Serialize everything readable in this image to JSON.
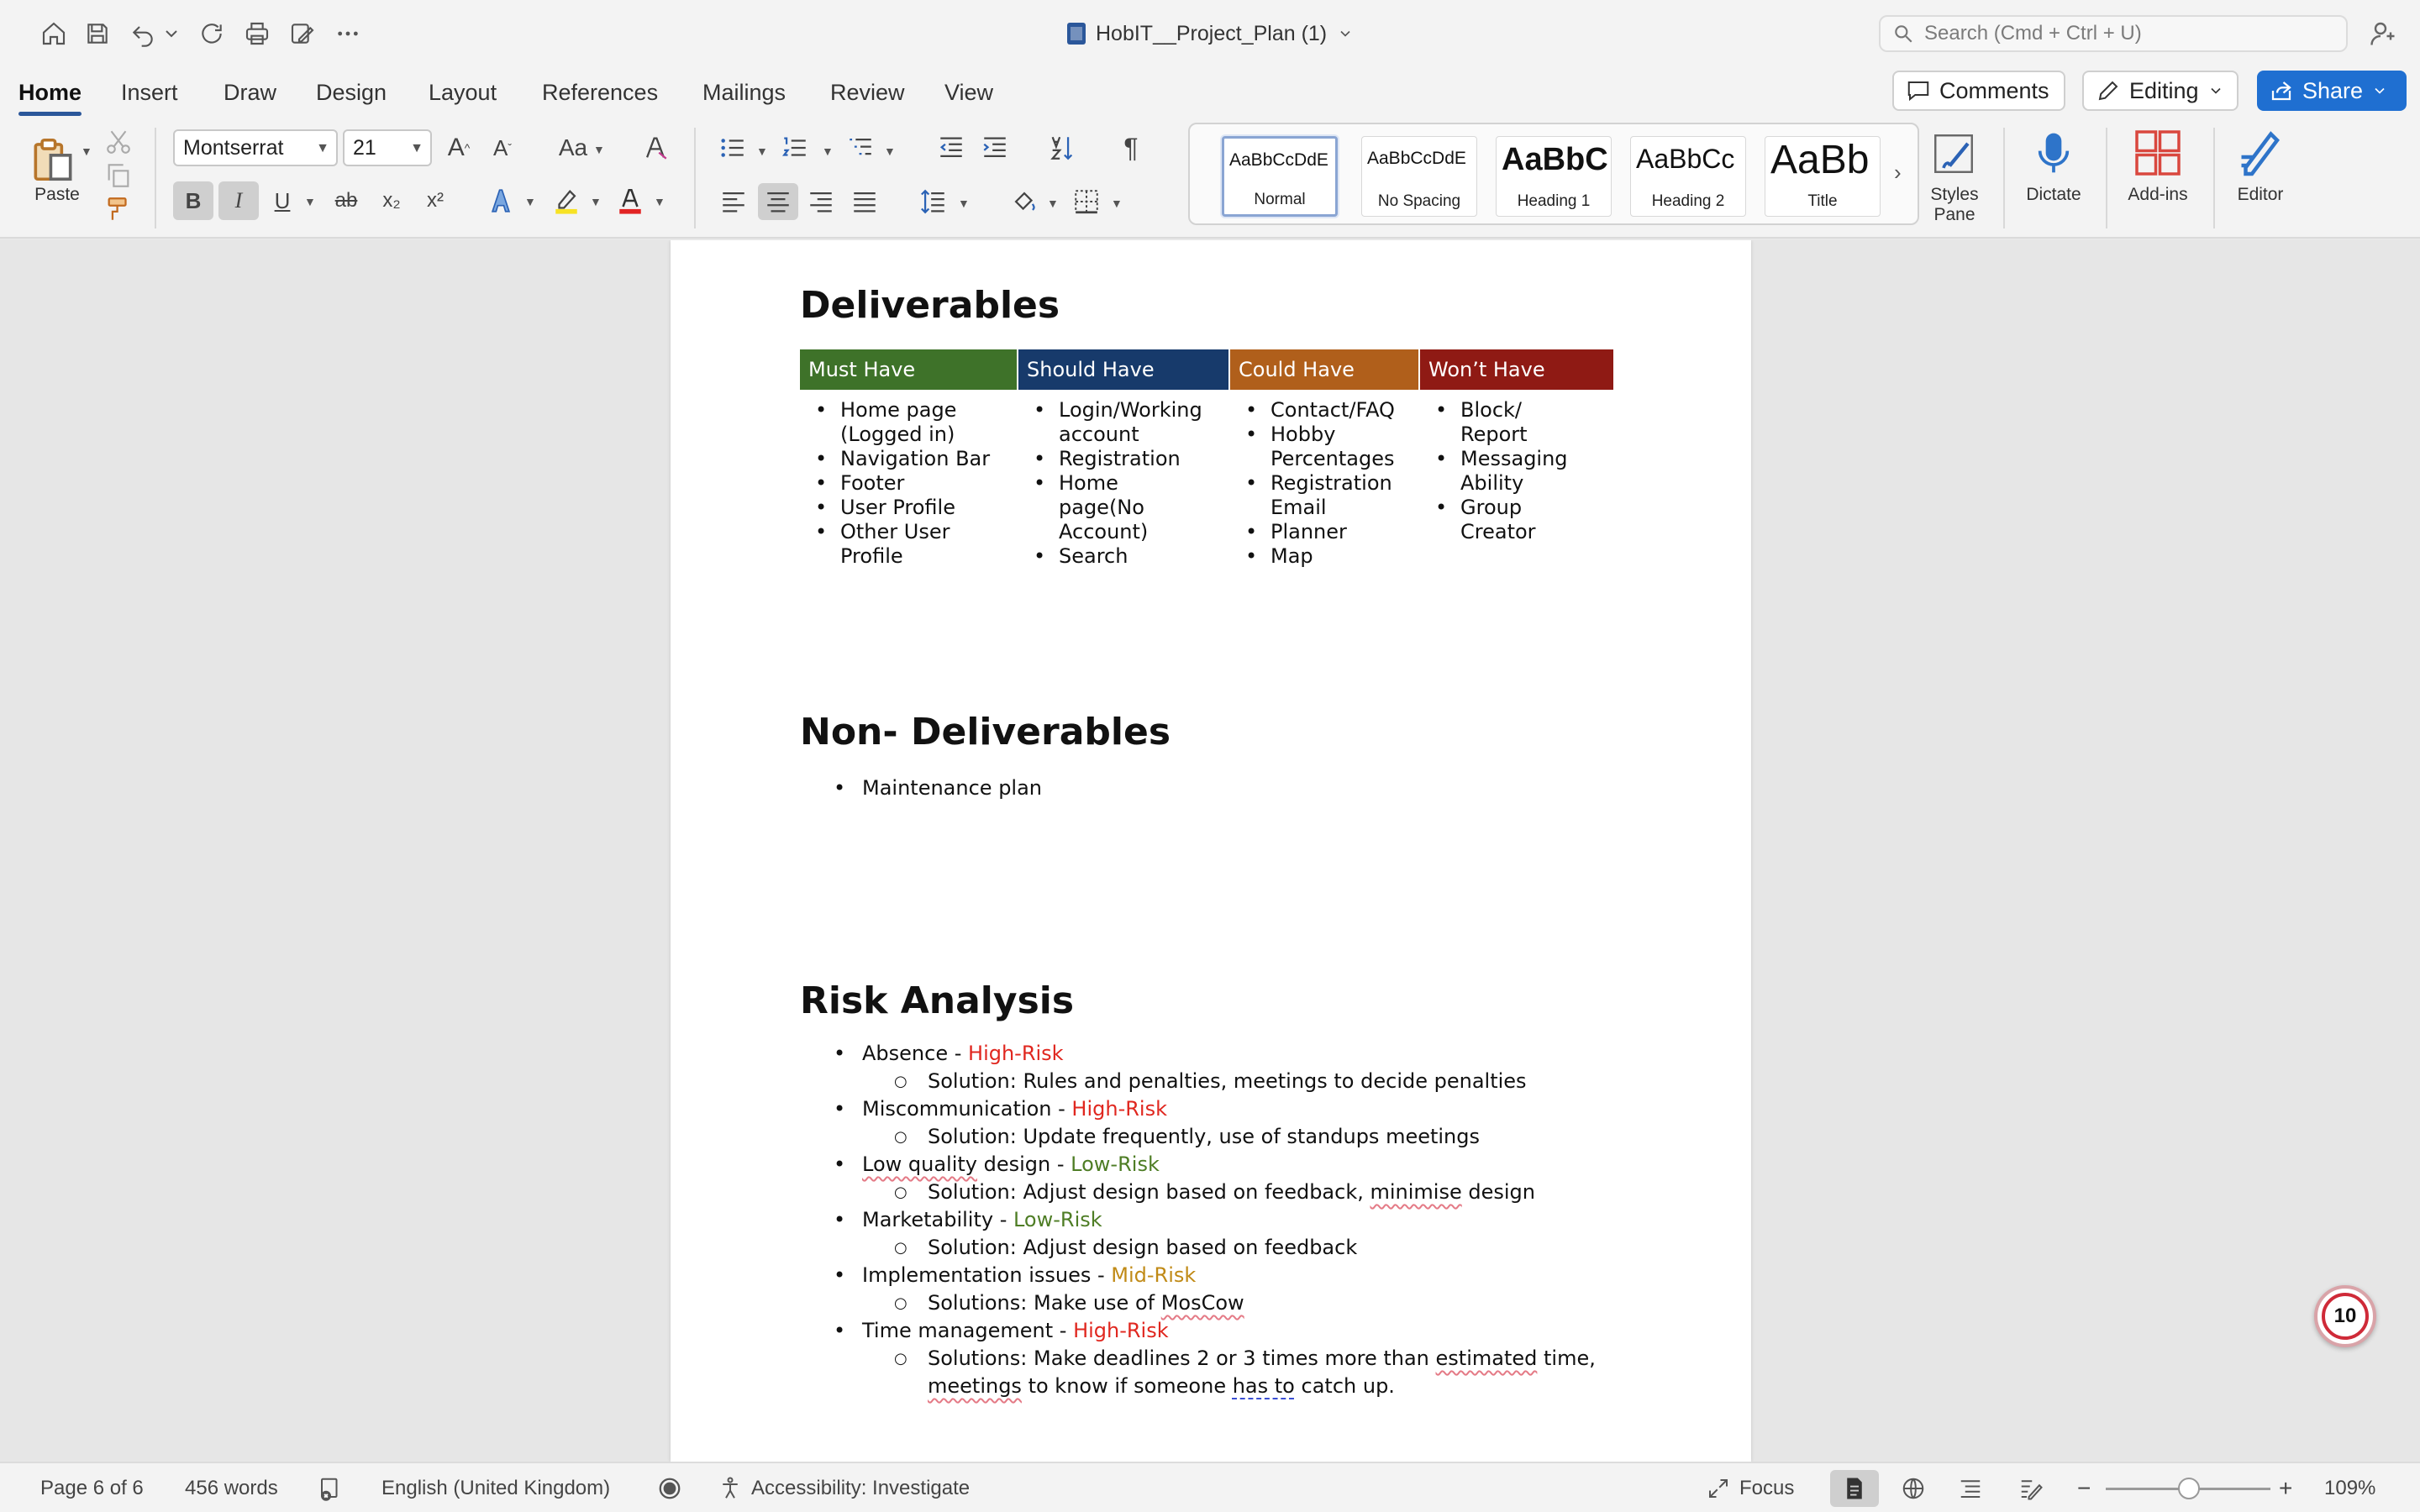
{
  "window": {
    "title": "HobIT__Project_Plan (1)",
    "search_placeholder": "Search (Cmd + Ctrl + U)"
  },
  "quick_access": [
    "home-icon",
    "save-icon",
    "undo-icon",
    "redo-icon",
    "print-icon",
    "edit-doc-icon",
    "more-icon"
  ],
  "tabs": [
    "Home",
    "Insert",
    "Draw",
    "Design",
    "Layout",
    "References",
    "Mailings",
    "Review",
    "View"
  ],
  "active_tab": "Home",
  "top_right": {
    "comments": "Comments",
    "editing": "Editing",
    "share": "Share"
  },
  "ribbon": {
    "paste_label": "Paste",
    "font_name": "Montserrat",
    "font_size": "21",
    "styles": [
      {
        "sample": "AaBbCcDdE",
        "name": "Normal"
      },
      {
        "sample": "AaBbCcDdE",
        "name": "No Spacing"
      },
      {
        "sample": "AaBbC",
        "name": "Heading 1"
      },
      {
        "sample": "AaBbCc",
        "name": "Heading 2"
      },
      {
        "sample": "AaBb",
        "name": "Title"
      }
    ],
    "styles_pane_label": "Styles\nPane",
    "styles_pane_line1": "Styles",
    "styles_pane_line2": "Pane",
    "dictate_label": "Dictate",
    "addins_label": "Add-ins",
    "editor_label": "Editor",
    "bold_label": "B",
    "italic_label": "I",
    "underline_label": "U",
    "strike_label": "ab",
    "subscript_label": "x₂",
    "superscript_label": "x²",
    "case_label": "Aa",
    "grow_label": "A",
    "shrink_label": "A"
  },
  "document": {
    "deliverables_heading": "Deliverables",
    "moscow": {
      "headers": [
        "Must Have",
        "Should Have",
        "Could Have",
        "Won’t Have"
      ],
      "colors": [
        "#3e7229",
        "#173a6b",
        "#b05f1b",
        "#8f1a14"
      ],
      "must": [
        "Home page\n(Logged in)",
        "Navigation Bar",
        "Footer",
        "User Profile",
        "Other User\nProfile"
      ],
      "should": [
        "Login/Working\naccount",
        "Registration",
        "Home\npage(No\nAccount)",
        "Search"
      ],
      "could": [
        "Contact/FAQ",
        "Hobby\nPercentages",
        "Registration\nEmail",
        "Planner",
        "Map"
      ],
      "wont": [
        "Block/\nReport",
        "Messaging\nAbility",
        "Group\nCreator"
      ]
    },
    "non_deliverables_heading": "Non- Deliverables",
    "non_deliverables": [
      "Maintenance plan"
    ],
    "risk_heading": "Risk Analysis",
    "risks": [
      {
        "name": "Absence - ",
        "level": "High-Risk",
        "solution": "Solution: Rules and penalties, meetings to decide penalties"
      },
      {
        "name": "Miscommunication - ",
        "level": "High-Risk",
        "solution": "Solution: Update frequently, use of standups meetings"
      },
      {
        "name_a": "Low quality",
        "name_b": " design - ",
        "level": "Low-Risk",
        "solution_a": "Solution: Adjust design based on feedback, ",
        "solution_b": "minimise",
        "solution_c": " design"
      },
      {
        "name": "Marketability - ",
        "level": "Low-Risk",
        "solution": "Solution: Adjust design based on feedback"
      },
      {
        "name": "Implementation issues - ",
        "level": "Mid-Risk",
        "solution_a": "Solutions: Make use of ",
        "solution_b": "MosCow"
      },
      {
        "name": "Time management - ",
        "level": "High-Risk",
        "solution_a": "Solutions: Make deadlines 2 or 3 times more than ",
        "solution_b": "estimated",
        "solution_c": " time,",
        "solution_d": "meetings",
        "solution_e": " to know if someone ",
        "solution_f": "has to",
        "solution_g": " catch up."
      }
    ],
    "risk_colors": {
      "High-Risk": "#e0271f",
      "Low-Risk": "#4e7d25",
      "Mid-Risk": "#c08a16"
    },
    "comment_count": "10"
  },
  "statusbar": {
    "page": "Page 6 of 6",
    "words": "456 words",
    "language": "English (United Kingdom)",
    "accessibility": "Accessibility: Investigate",
    "focus": "Focus",
    "zoom": "109%",
    "zoom_level_percent": 109
  }
}
